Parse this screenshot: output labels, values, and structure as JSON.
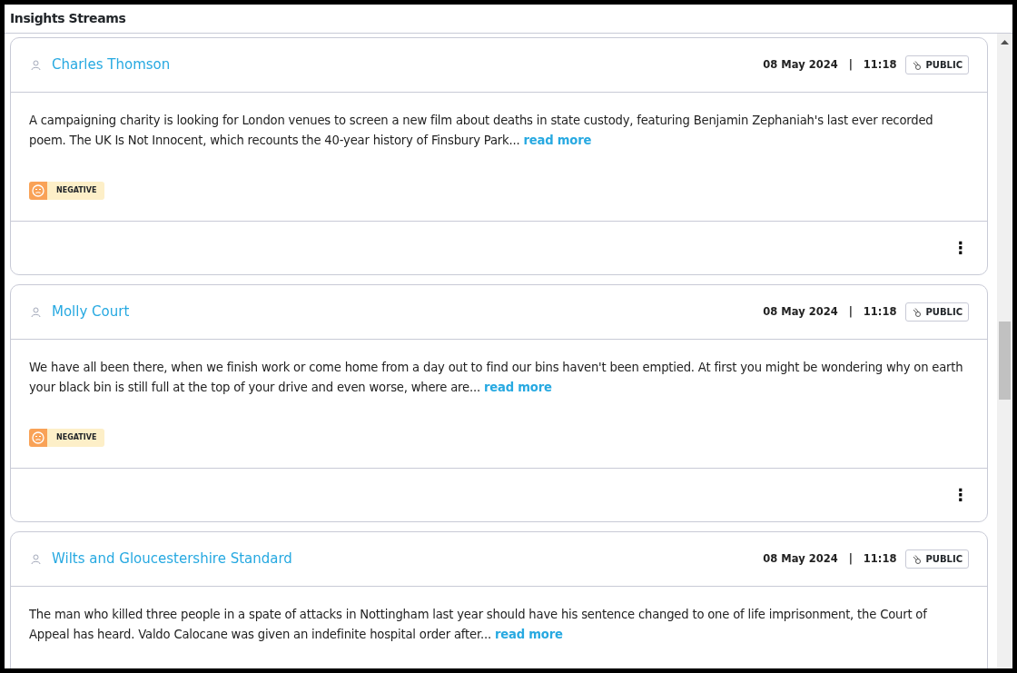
{
  "header": {
    "title": "Insights Streams"
  },
  "posts": [
    {
      "author": "Charles Thomson",
      "date": "08 May 2024",
      "separator": "|",
      "time": "11:18",
      "visibility": "PUBLIC",
      "text": "A campaigning charity is looking for London venues to screen a new film about deaths in state custody, featuring Benjamin Zephaniah's last ever recorded poem. The UK Is Not Innocent, which recounts the 40-year history of Finsbury Park...",
      "link": "read more",
      "sentiment": {
        "kind": "negative",
        "label": "NEGATIVE"
      },
      "menu": "⋮"
    },
    {
      "author": "Molly Court",
      "date": "08 May 2024",
      "separator": "|",
      "time": "11:18",
      "visibility": "PUBLIC",
      "text": "We have all been there, when we finish work or come home from a day out to find our bins haven't been emptied. At first you might be wondering why on earth your black bin is still full at the top of your drive and even worse, where are...",
      "link": "read more",
      "sentiment": {
        "kind": "negative",
        "label": "NEGATIVE"
      },
      "menu": "⋮"
    },
    {
      "author": "Wilts and Gloucestershire Standard",
      "date": "08 May 2024",
      "separator": "|",
      "time": "11:18",
      "visibility": "PUBLIC",
      "text": "The man who killed three people in a spate of attacks in Nottingham last year should have his sentence changed to one of life imprisonment, the Court of Appeal has heard. Valdo Calocane was given an indefinite hospital order after...",
      "link": "read more"
    }
  ]
}
